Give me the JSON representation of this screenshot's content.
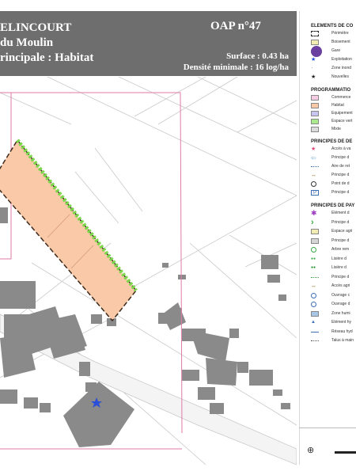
{
  "header": {
    "commune": "ELINCOURT",
    "site": "du Moulin",
    "vocation": "rincipale : Habitat",
    "oap_number": "OAP n°47",
    "surface": "Surface : 0.43 ha",
    "densite": "Densité minimale : 16 log/ha"
  },
  "legend": {
    "elements_title": "ELEMENTS DE CO",
    "elements": [
      {
        "label": "Périmètre",
        "icon": "dashed-rect-icon",
        "color": "#222222"
      },
      {
        "label": "Boisement",
        "icon": "fill-swatch-icon",
        "color": "#f3ecb0"
      },
      {
        "label": "Gare",
        "icon": "train-icon",
        "color": "#6b3fa0"
      },
      {
        "label": "Exploitation",
        "icon": "star-icon",
        "color": "#2b4fd6"
      },
      {
        "label": "Zone inond",
        "icon": "dot-icon",
        "color": "#999999"
      },
      {
        "label": "Nouvelles",
        "icon": "small-star-icon",
        "color": "#222222"
      }
    ],
    "programmation_title": "PROGRAMMATIO",
    "programmation": [
      {
        "label": "Commerce",
        "color": "#f4cde4"
      },
      {
        "label": "Habitat",
        "color": "#f9c9a8"
      },
      {
        "label": "Equipement",
        "color": "#c7c5ef"
      },
      {
        "label": "Espace vert",
        "color": "#a8ea8c"
      },
      {
        "label": "Mixte",
        "color": "#dcdcdc"
      }
    ],
    "desserte_title": "PRINCIPES DE DE",
    "desserte": [
      {
        "label": "Accès à va",
        "icon": "star-icon",
        "color": "#e0467a"
      },
      {
        "label": "Principe d",
        "icon": "arrow-left-icon",
        "color": "#6fa8dc"
      },
      {
        "label": "Aire de ret",
        "icon": "dotted-line-icon",
        "color": "#3d6fb5"
      },
      {
        "label": "Principe d",
        "icon": "double-arrow-icon",
        "color": "#8a5a00"
      },
      {
        "label": "Point de d",
        "icon": "circle-icon",
        "color": "#333333"
      },
      {
        "label": "Principe d",
        "icon": "parking-icon",
        "color": "#3d6fb5"
      }
    ],
    "paysage_title": "PRINCIPES DE PAY",
    "paysage": [
      {
        "label": "Elément d",
        "icon": "flower-icon",
        "color": "#9c3ec0"
      },
      {
        "label": "Principe d",
        "icon": "chevron-right-icon",
        "color": "#3aa843"
      },
      {
        "label": "Espace agri",
        "icon": "fill-swatch-icon",
        "color": "#f3ecb0"
      },
      {
        "label": "Principe d",
        "icon": "fill-swatch-icon",
        "color": "#d6d6d6"
      },
      {
        "label": "Arbre rem",
        "icon": "circle-icon",
        "color": "#3aa843"
      },
      {
        "label": "Lisière d",
        "icon": "tree-row-icon",
        "color": "#3aa843"
      },
      {
        "label": "Lisière d",
        "icon": "tree-pair-icon",
        "color": "#1f8b2a"
      },
      {
        "label": "Principe d",
        "icon": "dotted-line-icon",
        "color": "#3aa843"
      },
      {
        "label": "Accès agri",
        "icon": "double-arrow-icon",
        "color": "#8a5a00"
      },
      {
        "label": "Ouvrage c",
        "icon": "circle-icon",
        "color": "#3d6fb5"
      },
      {
        "label": "Ouvrage d",
        "icon": "circle-icon",
        "color": "#3d6fb5"
      },
      {
        "label": "Zone humi",
        "icon": "fill-swatch-icon",
        "color": "#a9c6e6"
      },
      {
        "label": "Elément hy",
        "icon": "triangle-icon",
        "color": "#3d6fb5"
      },
      {
        "label": "Réseau hyd",
        "icon": "line-icon",
        "color": "#3d6fb5"
      },
      {
        "label": "Talus à main",
        "icon": "dotted-line-icon",
        "color": "#555555"
      }
    ]
  },
  "map": {
    "building_color": "#8a8a8a",
    "habitat_color": "#f9c9a8",
    "hedge_color": "#7bd84a",
    "perimeter_color": "#e07aa6"
  }
}
